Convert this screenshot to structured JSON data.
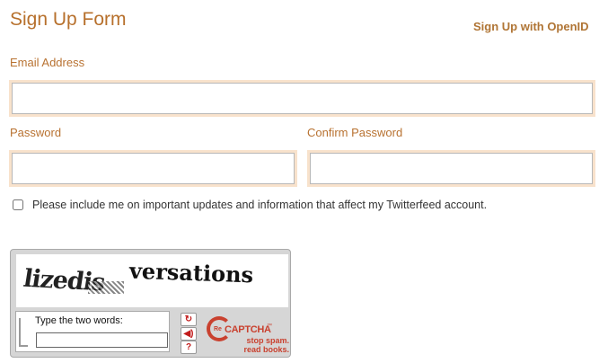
{
  "form": {
    "title": "Sign Up Form",
    "openid_link": "Sign Up with OpenID",
    "email_label": "Email Address",
    "email_value": "",
    "password_label": "Password",
    "password_value": "",
    "confirm_label": "Confirm Password",
    "confirm_value": "",
    "updates_checkbox_label": "Please include me on important updates and information that affect my Twitterfeed account.",
    "updates_checked": false
  },
  "captcha": {
    "word1": "lizedis",
    "word2": "versations",
    "prompt": "Type the two words:",
    "response_value": "",
    "buttons": [
      "refresh-icon",
      "audio-icon",
      "help-icon"
    ],
    "brand_prefix": "Re",
    "brand_name": "CAPTCHA",
    "brand_tm": "™",
    "tagline_line1": "stop spam.",
    "tagline_line2": "read books."
  },
  "colors": {
    "accent": "#b7702c",
    "field_glow": "#f8e2cc",
    "captcha_red": "#c9412f"
  }
}
